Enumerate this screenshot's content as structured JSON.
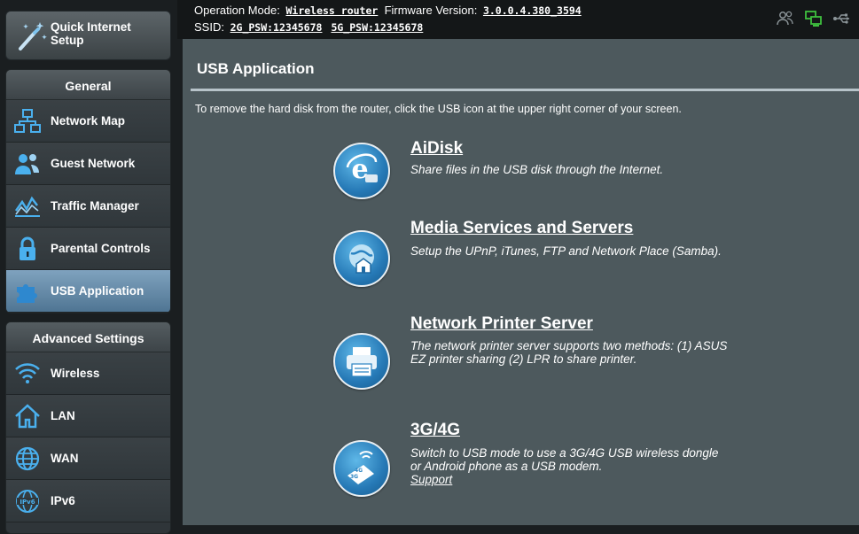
{
  "header": {
    "operation_mode_label": "Operation Mode:",
    "operation_mode_value": "Wireless router",
    "firmware_label": "Firmware Version:",
    "firmware_value": "3.0.0.4.380_3594",
    "ssid_label": "SSID:",
    "ssid_2g": "2G_PSW:12345678",
    "ssid_5g": "5G_PSW:12345678",
    "icons": [
      "users-icon",
      "network-status-icon",
      "usb-icon"
    ]
  },
  "sidebar": {
    "quick_setup_label": "Quick Internet Setup",
    "general_title": "General",
    "general_items": [
      {
        "label": "Network Map",
        "icon": "network-map-icon"
      },
      {
        "label": "Guest Network",
        "icon": "guest-network-icon"
      },
      {
        "label": "Traffic Manager",
        "icon": "traffic-manager-icon"
      },
      {
        "label": "Parental Controls",
        "icon": "lock-icon"
      },
      {
        "label": "USB Application",
        "icon": "puzzle-icon",
        "active": true
      }
    ],
    "advanced_title": "Advanced Settings",
    "advanced_items": [
      {
        "label": "Wireless",
        "icon": "wifi-icon"
      },
      {
        "label": "LAN",
        "icon": "home-icon"
      },
      {
        "label": "WAN",
        "icon": "globe-icon"
      },
      {
        "label": "IPv6",
        "icon": "ipv6-icon"
      }
    ]
  },
  "main": {
    "title": "USB Application",
    "notice": "To remove the hard disk from the router, click the USB icon at the upper right corner of your screen.",
    "apps": [
      {
        "title": "AiDisk",
        "desc": "Share files in the USB disk through the Internet.",
        "icon": "aidisk-icon"
      },
      {
        "title": "Media Services and Servers",
        "desc": "Setup the UPnP, iTunes, FTP and Network Place (Samba).",
        "icon": "media-server-icon"
      },
      {
        "title": "Network Printer Server",
        "desc": "The network printer server supports two methods: (1) ASUS EZ printer sharing (2) LPR to share printer.",
        "icon": "printer-icon"
      },
      {
        "title": "3G/4G",
        "desc": "Switch to USB mode to use a 3G/4G USB wireless dongle or Android phone as a USB modem.",
        "icon": "usb-modem-icon",
        "link": "Support"
      }
    ]
  },
  "colors": {
    "accent_blue": "#2679b6",
    "active_item": "#6a8eab",
    "panel": "#4d595d",
    "green_status": "#3fbf3f"
  }
}
